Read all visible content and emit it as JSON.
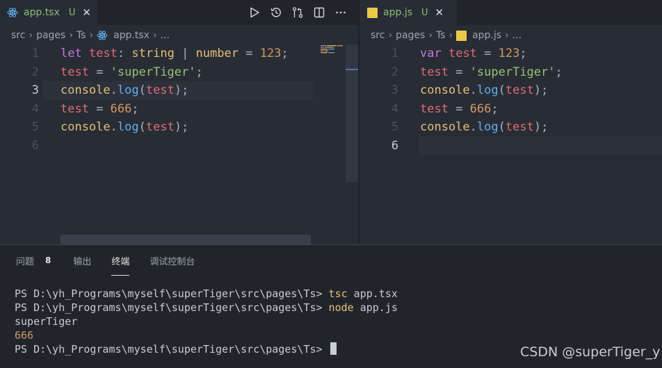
{
  "left_editor": {
    "tab": {
      "filename": "app.tsx",
      "status": "U",
      "icon": "react-icon"
    },
    "toolbar_icons": [
      "run-icon",
      "timeline-icon",
      "compare-changes-icon",
      "split-editor-icon",
      "more-actions-icon"
    ],
    "breadcrumb": {
      "parts": [
        "src",
        "pages",
        "Ts"
      ],
      "file": "app.tsx",
      "ellipsis": "..."
    },
    "lines": [
      {
        "num": "1",
        "tokens": [
          [
            "kw",
            "let"
          ],
          [
            "pl",
            " "
          ],
          [
            "var",
            "test"
          ],
          [
            "pl",
            ": "
          ],
          [
            "type",
            "string"
          ],
          [
            "pl",
            " | "
          ],
          [
            "type",
            "number"
          ],
          [
            "pl",
            " = "
          ],
          [
            "num",
            "123"
          ],
          [
            "pl",
            ";"
          ]
        ]
      },
      {
        "num": "2",
        "tokens": [
          [
            "var",
            "test"
          ],
          [
            "pl",
            " = "
          ],
          [
            "str",
            "'superTiger'"
          ],
          [
            "pl",
            ";"
          ]
        ]
      },
      {
        "num": "3",
        "tokens": [
          [
            "type",
            "console"
          ],
          [
            "pl",
            "."
          ],
          [
            "fn",
            "log"
          ],
          [
            "pl",
            "("
          ],
          [
            "var",
            "test"
          ],
          [
            "pl",
            ");"
          ]
        ]
      },
      {
        "num": "4",
        "tokens": [
          [
            "var",
            "test"
          ],
          [
            "pl",
            " = "
          ],
          [
            "num",
            "666"
          ],
          [
            "pl",
            ";"
          ]
        ]
      },
      {
        "num": "5",
        "tokens": [
          [
            "type",
            "console"
          ],
          [
            "pl",
            "."
          ],
          [
            "fn",
            "log"
          ],
          [
            "pl",
            "("
          ],
          [
            "var",
            "test"
          ],
          [
            "pl",
            ");"
          ]
        ]
      },
      {
        "num": "6",
        "tokens": []
      }
    ],
    "active_line": "3"
  },
  "right_editor": {
    "tab": {
      "filename": "app.js",
      "status": "U",
      "icon": "javascript-icon",
      "icon_label": "JS"
    },
    "breadcrumb": {
      "parts": [
        "src",
        "pages",
        "Ts"
      ],
      "file": "app.js",
      "ellipsis": "...",
      "icon_label": "JS"
    },
    "lines": [
      {
        "num": "1",
        "tokens": [
          [
            "kw",
            "var"
          ],
          [
            "pl",
            " "
          ],
          [
            "var",
            "test"
          ],
          [
            "pl",
            " = "
          ],
          [
            "num",
            "123"
          ],
          [
            "pl",
            ";"
          ]
        ]
      },
      {
        "num": "2",
        "tokens": [
          [
            "var",
            "test"
          ],
          [
            "pl",
            " = "
          ],
          [
            "str",
            "'superTiger'"
          ],
          [
            "pl",
            ";"
          ]
        ]
      },
      {
        "num": "3",
        "tokens": [
          [
            "type",
            "console"
          ],
          [
            "pl",
            "."
          ],
          [
            "fn",
            "log"
          ],
          [
            "pl",
            "("
          ],
          [
            "var",
            "test"
          ],
          [
            "pl",
            ");"
          ]
        ]
      },
      {
        "num": "4",
        "tokens": [
          [
            "var",
            "test"
          ],
          [
            "pl",
            " = "
          ],
          [
            "num",
            "666"
          ],
          [
            "pl",
            ";"
          ]
        ]
      },
      {
        "num": "5",
        "tokens": [
          [
            "type",
            "console"
          ],
          [
            "pl",
            "."
          ],
          [
            "fn",
            "log"
          ],
          [
            "pl",
            "("
          ],
          [
            "var",
            "test"
          ],
          [
            "pl",
            ");"
          ]
        ]
      },
      {
        "num": "6",
        "tokens": []
      }
    ],
    "active_line": "6"
  },
  "panel": {
    "tabs": [
      {
        "label": "问题",
        "badge": "8",
        "active": false
      },
      {
        "label": "输出",
        "active": false
      },
      {
        "label": "终端",
        "active": true
      },
      {
        "label": "调试控制台",
        "active": false
      }
    ],
    "terminal": [
      {
        "prompt": "PS D:\\yh_Programs\\myself\\superTiger\\src\\pages\\Ts> ",
        "cmd": "tsc",
        "args": " app.tsx"
      },
      {
        "prompt": "PS D:\\yh_Programs\\myself\\superTiger\\src\\pages\\Ts> ",
        "cmd": "node",
        "args": " app.js"
      },
      {
        "output": "superTiger"
      },
      {
        "output": "666",
        "numeric": true
      },
      {
        "prompt": "PS D:\\yh_Programs\\myself\\superTiger\\src\\pages\\Ts> ",
        "cursor": true
      }
    ]
  },
  "watermark": "CSDN @superTiger_y",
  "colors": {
    "editor_bg": "#282c34",
    "tabbar_bg": "#21252b",
    "keyword": "#c678dd",
    "variable": "#e06c75",
    "type": "#e5c07b",
    "number": "#d19a66",
    "string": "#98c379",
    "function": "#61afef",
    "untracked": "#8fc07a"
  }
}
